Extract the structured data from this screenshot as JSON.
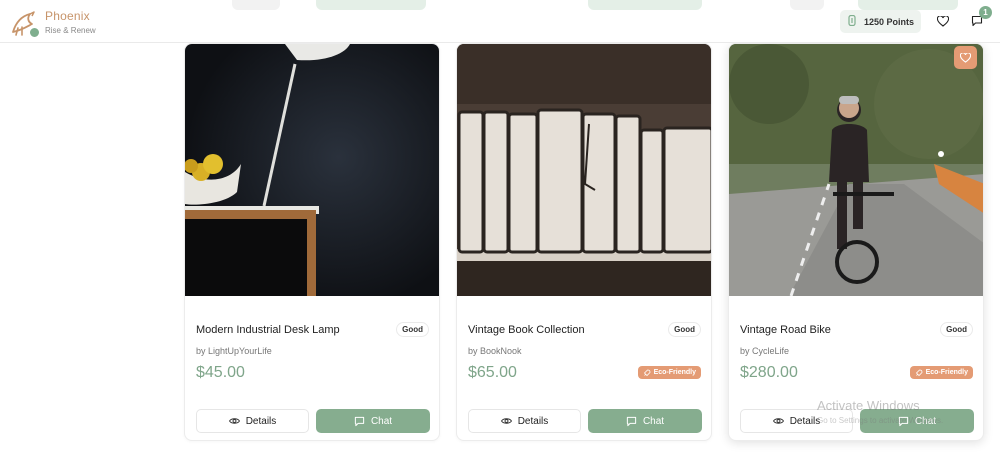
{
  "brand": {
    "name": "Phoenix",
    "tagline": "Rise & Renew"
  },
  "header": {
    "points_label": "1250 Points",
    "notification_count": "1",
    "icons": [
      "coin-icon",
      "heart-icon",
      "chat-icon"
    ]
  },
  "colors": {
    "accent": "#86ad8f",
    "brand": "#c7946a",
    "eco": "#e49b74",
    "price": "#7fa58a"
  },
  "products": [
    {
      "title": "Modern Industrial Desk Lamp",
      "condition": "Good",
      "seller": "by LightUpYourLife",
      "price": "$45.00",
      "eco": "",
      "details_label": "Details",
      "chat_label": "Chat"
    },
    {
      "title": "Vintage Book Collection",
      "condition": "Good",
      "seller": "by BookNook",
      "price": "$65.00",
      "eco": "Eco-Friendly",
      "details_label": "Details",
      "chat_label": "Chat"
    },
    {
      "title": "Vintage Road Bike",
      "condition": "Good",
      "seller": "by CycleLife",
      "price": "$280.00",
      "eco": "Eco-Friendly",
      "details_label": "Details",
      "chat_label": "Chat"
    }
  ],
  "watermark": {
    "title": "Activate Windows",
    "subtitle": "Go to Settings to activate Windows."
  }
}
